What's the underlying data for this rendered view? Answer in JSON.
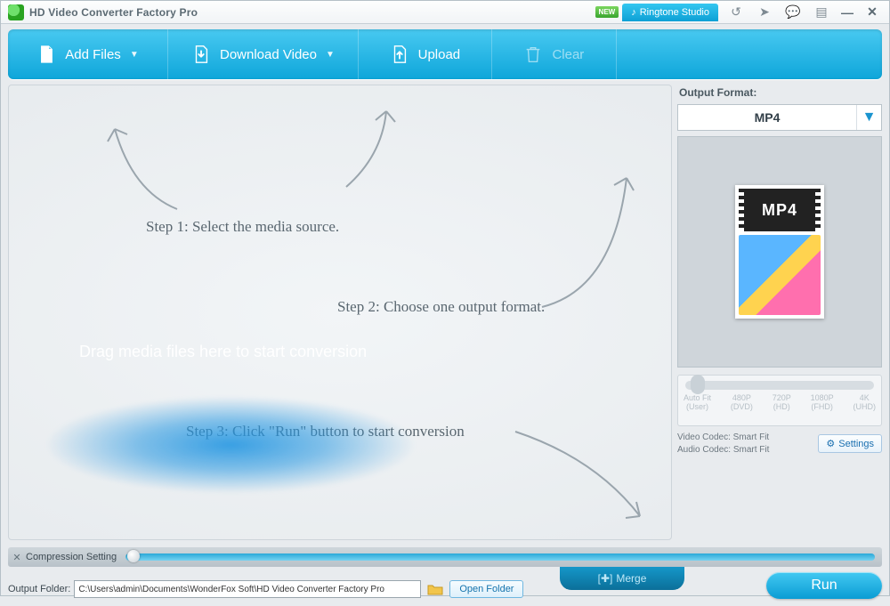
{
  "titlebar": {
    "app_title": "HD Video Converter Factory Pro",
    "new_badge": "NEW",
    "ringtone_label": "Ringtone Studio"
  },
  "toolbar": {
    "add_files": "Add Files",
    "download_video": "Download Video",
    "upload": "Upload",
    "clear": "Clear"
  },
  "drop": {
    "step1": "Step 1: Select the media source.",
    "step2": "Step 2: Choose one output format.",
    "step3": "Step 3: Click \"Run\" button to start conversion",
    "drag_text": "Drag media files here to start conversion"
  },
  "output": {
    "panel_title": "Output Format:",
    "format": "MP4",
    "thumb_label": "MP4",
    "resolutions": [
      {
        "a": "Auto Fit",
        "b": "(User)"
      },
      {
        "a": "480P",
        "b": "(DVD)"
      },
      {
        "a": "720P",
        "b": "(HD)"
      },
      {
        "a": "1080P",
        "b": "(FHD)"
      },
      {
        "a": "4K",
        "b": "(UHD)"
      }
    ],
    "video_codec_line": "Video Codec: Smart Fit",
    "audio_codec_line": "Audio Codec: Smart Fit",
    "settings_label": "Settings"
  },
  "compression": {
    "label": "Compression Setting"
  },
  "bottom": {
    "output_folder_label": "Output Folder:",
    "output_folder_value": "C:\\Users\\admin\\Documents\\WonderFox Soft\\HD Video Converter Factory Pro",
    "open_folder": "Open Folder",
    "merge": "Merge",
    "run": "Run"
  }
}
